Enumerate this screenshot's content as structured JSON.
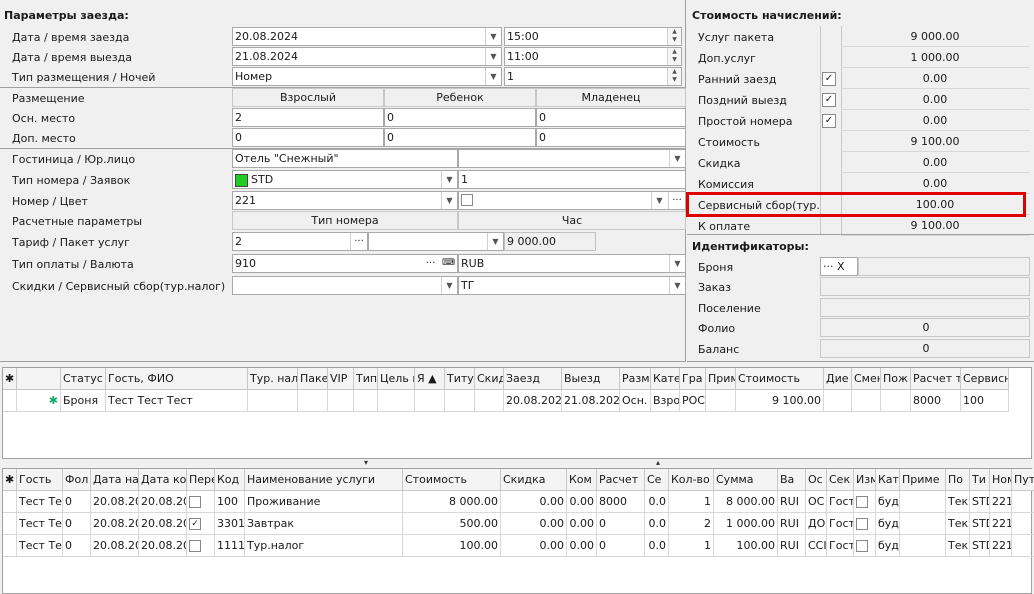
{
  "left": {
    "title": "Параметры заезда:",
    "checkin_label": "Дата / время заезда",
    "checkin_date": "20.08.2024",
    "checkin_time": "15:00",
    "checkout_label": "Дата / время выезда",
    "checkout_date": "21.08.2024",
    "checkout_time": "11:00",
    "placement_label": "Тип размещения / Ночей",
    "placement_value": "Номер",
    "nights": "1",
    "accommodation_label": "Размещение",
    "col_adult": "Взрослый",
    "col_child": "Ребенок",
    "col_infant": "Младенец",
    "main_place_label": "Осн. место",
    "main_adult": "2",
    "main_child": "0",
    "main_infant": "0",
    "extra_place_label": "Доп. место",
    "extra_adult": "0",
    "extra_child": "0",
    "extra_infant": "0",
    "hotel_label": "Гостиница / Юр.лицо",
    "hotel_value": "Отель \"Снежный\"",
    "room_type_label": "Тип номера / Заявок",
    "room_type_value": "STD",
    "room_type_color": "#22cc22",
    "requests": "1",
    "room_label": "Номер / Цвет",
    "room_value": "221",
    "calc_label": "Расчетные параметры",
    "col_room_type": "Тип номера",
    "col_hour": "Час",
    "tariff_label": "Тариф / Пакет услуг",
    "tariff_value": "2",
    "tariff_amount": "9 000.00",
    "payment_label": "Тип оплаты / Валюта",
    "payment_value": "910",
    "currency": "RUB",
    "discount_label": "Скидки / Сервисный сбор(тур.налог)",
    "discount_value": "",
    "service_fee_value": "ТГ"
  },
  "right": {
    "title": "Стоимость начислений:",
    "rows": [
      {
        "label": "Услуг пакета",
        "value": "9 000.00",
        "check": ""
      },
      {
        "label": "Доп.услуг",
        "value": "1 000.00",
        "check": ""
      },
      {
        "label": "Ранний заезд",
        "value": "0.00",
        "check": "✓"
      },
      {
        "label": "Поздний выезд",
        "value": "0.00",
        "check": "✓"
      },
      {
        "label": "Простой номера",
        "value": "0.00",
        "check": "✓"
      },
      {
        "label": "Стоимость",
        "value": "9 100.00",
        "check": ""
      },
      {
        "label": "Скидка",
        "value": "0.00",
        "check": ""
      },
      {
        "label": "Комиссия",
        "value": "0.00",
        "check": ""
      },
      {
        "label": "Сервисный сбор(тур.",
        "value": "100.00",
        "check": ""
      },
      {
        "label": "К оплате",
        "value": "9 100.00",
        "check": ""
      }
    ],
    "ids_title": "Идентификаторы:",
    "booking_label": "Броня",
    "booking_btn": "···",
    "booking_x": "X",
    "order_label": "Заказ",
    "settle_label": "Поселение",
    "folio_label": "Фолио",
    "folio_value": "0",
    "balance_label": "Баланс",
    "balance_value": "0"
  },
  "guests_grid": {
    "headers": [
      "Статус",
      "Гость, ФИО",
      "Тур. нал",
      "Паке",
      "VIP",
      "Тип",
      "Цель г",
      "Я ▲",
      "Титу",
      "Скид",
      "Заезд",
      "Выезд",
      "Разм",
      "Кате",
      "Гра",
      "Прим",
      "Стоимость",
      "Дие",
      "Смен",
      "Пож",
      "Расчет т",
      "Сервисн"
    ],
    "row": [
      "Броня",
      "Тест Тест Тест",
      "",
      "",
      "",
      "",
      "",
      "",
      "",
      "",
      "20.08.202",
      "21.08.202",
      "Осн.",
      "Взро",
      "РОС",
      "",
      "9 100.00",
      "",
      "",
      "",
      "8000",
      "100"
    ]
  },
  "services_grid": {
    "headers": [
      "Гость",
      "Фол",
      "Дата на",
      "Дата ко",
      "Пере",
      "Код",
      "Наименование услуги",
      "Стоимость",
      "Скидка",
      "Ком",
      "Расчет",
      "Се",
      "Кол-во",
      "Сумма",
      "Ва",
      "Ос",
      "Сек",
      "Изм",
      "Кат",
      "Приме",
      "По",
      "Ти",
      "Ном",
      "Пут"
    ],
    "rows": [
      [
        "Тест Те",
        "0",
        "20.08.20",
        "20.08.20",
        "",
        "100",
        "Проживание",
        "8 000.00",
        "0.00",
        "0.00",
        "8000",
        "0.0",
        "1",
        "8 000.00",
        "RUI",
        "ОС",
        "Гост",
        "",
        "буд",
        "",
        "Тек",
        "STD",
        "221",
        ""
      ],
      [
        "Тест Те",
        "0",
        "20.08.20",
        "20.08.20",
        "✓",
        "3301",
        "Завтрак",
        "500.00",
        "0.00",
        "0.00",
        "0",
        "0.0",
        "2",
        "1 000.00",
        "RUI",
        "ДО",
        "Гост",
        "",
        "буд",
        "",
        "Тек",
        "STD",
        "221",
        ""
      ],
      [
        "Тест Те",
        "0",
        "20.08.20",
        "20.08.20",
        "",
        "1111",
        "Тур.налог",
        "100.00",
        "0.00",
        "0.00",
        "0",
        "0.0",
        "1",
        "100.00",
        "RUI",
        "ССІ",
        "Гост",
        "",
        "буд",
        "",
        "Тек",
        "STD",
        "221",
        ""
      ]
    ]
  },
  "colors": {
    "highlight": "#e00000",
    "panel_bg": "#f0f0f0"
  }
}
